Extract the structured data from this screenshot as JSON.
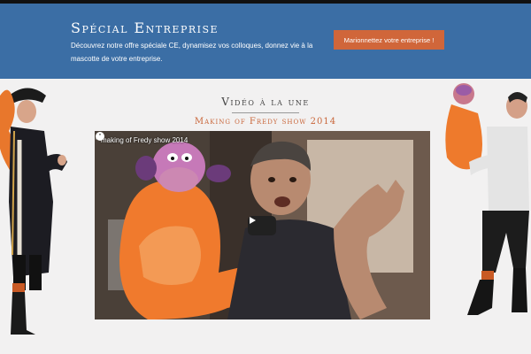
{
  "banner": {
    "title": "Spécial Entreprise",
    "text": "Découvrez notre offre spéciale CE, dynamisez vos colloques, donnez vie à la mascotte de votre entreprise.",
    "cta_label": "Marionnettez votre entreprise !"
  },
  "section": {
    "heading": "Vidéo à la une",
    "video_title": "Making of Fredy show 2014"
  },
  "player": {
    "title": "making of Fredy show 2014",
    "icons": [
      "clock-icon",
      "share-icon",
      "play-icon"
    ]
  },
  "colors": {
    "banner_bg": "#3b6ea5",
    "cta_bg": "#d0663a",
    "accent": "#c9663a",
    "page_bg": "#f2f1f1"
  }
}
